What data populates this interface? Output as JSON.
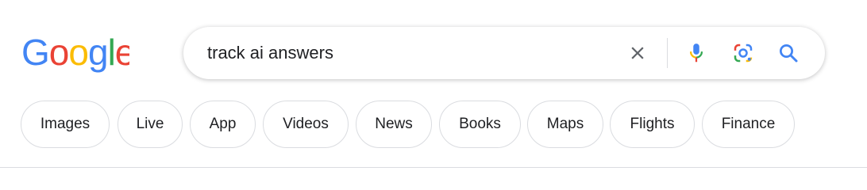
{
  "logo": {
    "text": "Google",
    "colors": [
      "#4285F4",
      "#EA4335",
      "#FBBC05",
      "#4285F4",
      "#34A853",
      "#EA4335"
    ]
  },
  "search": {
    "query": "track ai answers",
    "clear_icon": "close-icon",
    "mic_icon": "microphone-icon",
    "lens_icon": "lens-camera-icon",
    "search_icon": "search-icon"
  },
  "chips": [
    {
      "label": "Images"
    },
    {
      "label": "Live"
    },
    {
      "label": "App"
    },
    {
      "label": "Videos"
    },
    {
      "label": "News"
    },
    {
      "label": "Books"
    },
    {
      "label": "Maps"
    },
    {
      "label": "Flights"
    },
    {
      "label": "Finance"
    }
  ],
  "colors": {
    "blue": "#4285F4",
    "red": "#EA4335",
    "yellow": "#FBBC05",
    "green": "#34A853",
    "icon_gray": "#5f6368",
    "border": "#dadce0"
  }
}
